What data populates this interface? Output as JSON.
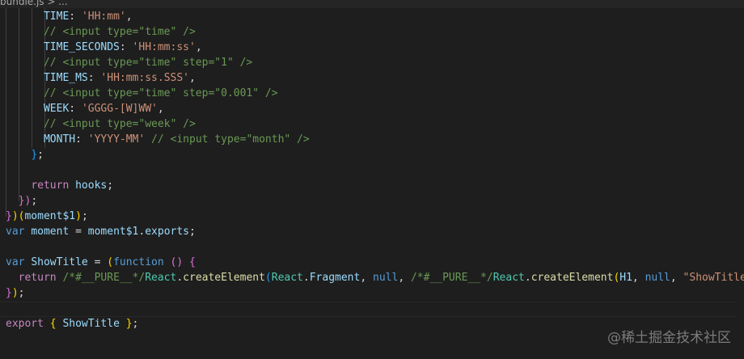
{
  "breadcrumb": {
    "text": "bundle.js > ..."
  },
  "code": {
    "l1": {
      "key": "TIME",
      "colon": ": ",
      "value": "'HH:mm'",
      "tail": ","
    },
    "l2": {
      "comment": "// <input type=\"time\" />"
    },
    "l3": {
      "key": "TIME_SECONDS",
      "colon": ": ",
      "value": "'HH:mm:ss'",
      "tail": ","
    },
    "l4": {
      "comment": "// <input type=\"time\" step=\"1\" />"
    },
    "l5": {
      "key": "TIME_MS",
      "colon": ": ",
      "value": "'HH:mm:ss.SSS'",
      "tail": ","
    },
    "l6": {
      "comment": "// <input type=\"time\" step=\"0.001\" />"
    },
    "l7": {
      "key": "WEEK",
      "colon": ": ",
      "value": "'GGGG-[W]WW'",
      "tail": ","
    },
    "l8": {
      "comment": "// <input type=\"week\" />"
    },
    "l9": {
      "key": "MONTH",
      "colon": ": ",
      "value": "'YYYY-MM'",
      "space": " ",
      "comment": "// <input type=\"month\" />"
    },
    "l10": {
      "brace": "}",
      "tail": ";"
    },
    "l12": {
      "keyword": "return",
      "space": " ",
      "ident": "hooks",
      "tail": ";"
    },
    "l13": {
      "brace": "}",
      "paren": ")",
      "tail": ";"
    },
    "l14": {
      "brace": "}",
      "paren_close": ")",
      "paren_open": "(",
      "ident": "moment$1",
      "paren_end": ")",
      "tail": ";"
    },
    "l15": {
      "keyword": "var",
      "space": " ",
      "ident": "moment",
      "eq": " = ",
      "obj": "moment$1",
      "dot": ".",
      "prop": "exports",
      "tail": ";"
    },
    "l17": {
      "keyword": "var",
      "space": " ",
      "ident": "ShowTitle",
      "eq": " = ",
      "paren": "(",
      "fn_kw": "function",
      "sp2": " ",
      "parens": "()",
      "sp3": " ",
      "brace": "{"
    },
    "l18": {
      "keyword": "return",
      "space": " ",
      "comment1": "/*#__PURE__*/",
      "obj1": "React",
      "dot1": ".",
      "fn1": "createElement",
      "paren1": "(",
      "obj2": "React",
      "dot2": ".",
      "prop2": "Fragment",
      "comma1": ", ",
      "null1": "null",
      "comma2": ", ",
      "comment2": "/*#__PURE__*/",
      "obj3": "React",
      "dot3": ".",
      "fn2": "createElement",
      "paren2": "(",
      "ident": "H1",
      "comma3": ", ",
      "null2": "null",
      "comma4": ", ",
      "str": "\"ShowTitle"
    },
    "l19": {
      "brace": "}",
      "paren": ")",
      "tail": ";"
    },
    "l21": {
      "keyword": "export",
      "space": " ",
      "brace_open": "{",
      "ident": " ShowTitle ",
      "brace_close": "}",
      "tail": ";"
    }
  },
  "watermark": "@稀土掘金技术社区"
}
